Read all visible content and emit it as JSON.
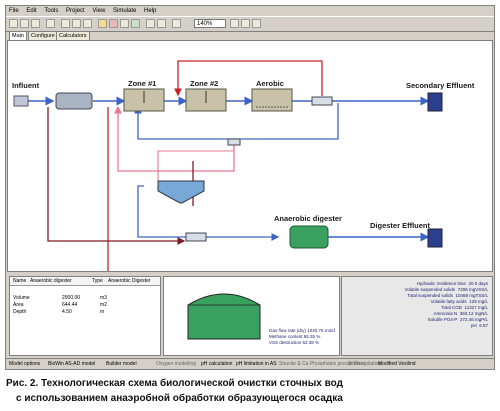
{
  "menu": [
    "File",
    "Edit",
    "Tools",
    "Project",
    "View",
    "Simulate",
    "Help"
  ],
  "toolbar": {
    "zoom": "140%"
  },
  "tabs": [
    "Main",
    "Configure",
    "Calculators"
  ],
  "diagram": {
    "influent": "Influent",
    "zone1": "Zone #1",
    "zone2": "Zone #2",
    "aerobic": "Aerobic",
    "secondary_effluent": "Secondary Effluent",
    "anaerobic_digester": "Anaerobic digester",
    "digester_effluent": "Digester Effluent"
  },
  "properties": {
    "name_label": "Name",
    "name_value": "Anaerobic digester",
    "type_label": "Type",
    "type_value": "Anaerobic Digester",
    "rows": [
      {
        "label": "Volume",
        "value": "2900.00",
        "unit": "m3"
      },
      {
        "label": "Area",
        "value": "644.44",
        "unit": "m2"
      },
      {
        "label": "Depth",
        "value": "4.50",
        "unit": "m"
      }
    ]
  },
  "results": {
    "rows": [
      {
        "label": "Hydraulic residence time",
        "value": "20.0",
        "unit": "days"
      },
      {
        "label": "Volatile suspended solids",
        "value": "7206",
        "unit": "mgVSS/L"
      },
      {
        "label": "Total suspended solids",
        "value": "10468",
        "unit": "mgTSS/L"
      },
      {
        "label": "Volatile fatty acids",
        "value": "129",
        "unit": "mg/L"
      },
      {
        "label": "Total COD",
        "value": "11327",
        "unit": "mg/L"
      },
      {
        "label": "Ammonia N",
        "value": "384.12",
        "unit": "mgN/L"
      },
      {
        "label": "Soluble PO4-P",
        "value": "272.46",
        "unit": "mgP/L"
      },
      {
        "label": "pH",
        "value": "6.57",
        "unit": ""
      }
    ],
    "gas_rows": [
      {
        "label": "Gas flow rate (dry)",
        "value": "1040.76",
        "unit": "m3/d"
      },
      {
        "label": "Methane content",
        "value": "65.35",
        "unit": "%"
      },
      {
        "label": "VSS destruction",
        "value": "52.38",
        "unit": "%"
      }
    ]
  },
  "status": {
    "model_options": "Model options",
    "model": "BioWin AS-AD model",
    "builder": "Builder model",
    "oxygen": "Oxygen modelling",
    "ph_calc": "pH calculation",
    "ph_limit": "pH limitation in AS",
    "struvite": "Struvite & Ca Phosphates precipitation",
    "al_fe": "Al Precipitation",
    "modified": "Modified Vesilind"
  },
  "caption": {
    "line1": "Рис. 2. Технологическая схема биологической очистки сточных вод",
    "line2": "с использованием анаэробной обработки образующегося осадка"
  },
  "colors": {
    "blue_line": "#3d63c4",
    "red_line": "#c8202a",
    "pink_line": "#e87890",
    "dark_red_line": "#7a1e24",
    "tank_green": "#3aa060"
  }
}
